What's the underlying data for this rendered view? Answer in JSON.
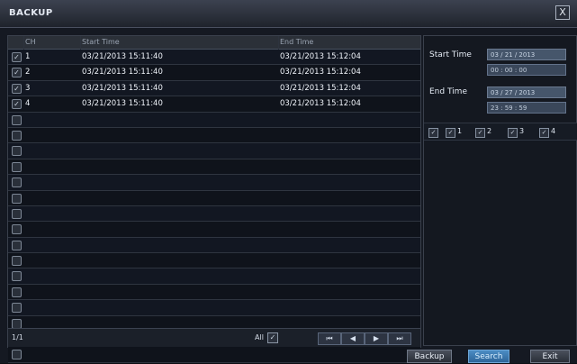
{
  "window": {
    "title": "BACKUP",
    "close": "X"
  },
  "table": {
    "headers": {
      "ch": "CH",
      "start": "Start Time",
      "end": "End Time"
    },
    "rows": [
      {
        "checked": true,
        "ch": "1",
        "start": "03/21/2013 15:11:40",
        "end": "03/21/2013 15:12:04"
      },
      {
        "checked": true,
        "ch": "2",
        "start": "03/21/2013 15:11:40",
        "end": "03/21/2013 15:12:04"
      },
      {
        "checked": true,
        "ch": "3",
        "start": "03/21/2013 15:11:40",
        "end": "03/21/2013 15:12:04"
      },
      {
        "checked": true,
        "ch": "4",
        "start": "03/21/2013 15:11:40",
        "end": "03/21/2013 15:12:04"
      },
      {
        "checked": false,
        "ch": "",
        "start": "",
        "end": ""
      },
      {
        "checked": false,
        "ch": "",
        "start": "",
        "end": ""
      },
      {
        "checked": false,
        "ch": "",
        "start": "",
        "end": ""
      },
      {
        "checked": false,
        "ch": "",
        "start": "",
        "end": ""
      },
      {
        "checked": false,
        "ch": "",
        "start": "",
        "end": ""
      },
      {
        "checked": false,
        "ch": "",
        "start": "",
        "end": ""
      },
      {
        "checked": false,
        "ch": "",
        "start": "",
        "end": ""
      },
      {
        "checked": false,
        "ch": "",
        "start": "",
        "end": ""
      },
      {
        "checked": false,
        "ch": "",
        "start": "",
        "end": ""
      },
      {
        "checked": false,
        "ch": "",
        "start": "",
        "end": ""
      },
      {
        "checked": false,
        "ch": "",
        "start": "",
        "end": ""
      },
      {
        "checked": false,
        "ch": "",
        "start": "",
        "end": ""
      },
      {
        "checked": false,
        "ch": "",
        "start": "",
        "end": ""
      },
      {
        "checked": false,
        "ch": "",
        "start": "",
        "end": ""
      },
      {
        "checked": false,
        "ch": "",
        "start": "",
        "end": ""
      },
      {
        "checked": false,
        "ch": "",
        "start": "",
        "end": ""
      }
    ],
    "footer": {
      "page_text": "1/1",
      "all_label": "All"
    },
    "nav": {
      "first": "⏮",
      "prev": "◀",
      "next": "▶",
      "last": "⏭"
    }
  },
  "filter": {
    "start_time_label": "Start Time",
    "start_date": "03 / 21 / 2013",
    "start_time": "00 : 00 : 00",
    "end_time_label": "End Time",
    "end_date": "03 / 27 / 2013",
    "end_time": "23 : 59 : 59",
    "channels": [
      {
        "label": "1",
        "checked": true
      },
      {
        "label": "2",
        "checked": true
      },
      {
        "label": "3",
        "checked": true
      },
      {
        "label": "4",
        "checked": true
      }
    ]
  },
  "buttons": {
    "backup": "Backup",
    "search": "Search",
    "exit": "Exit"
  }
}
